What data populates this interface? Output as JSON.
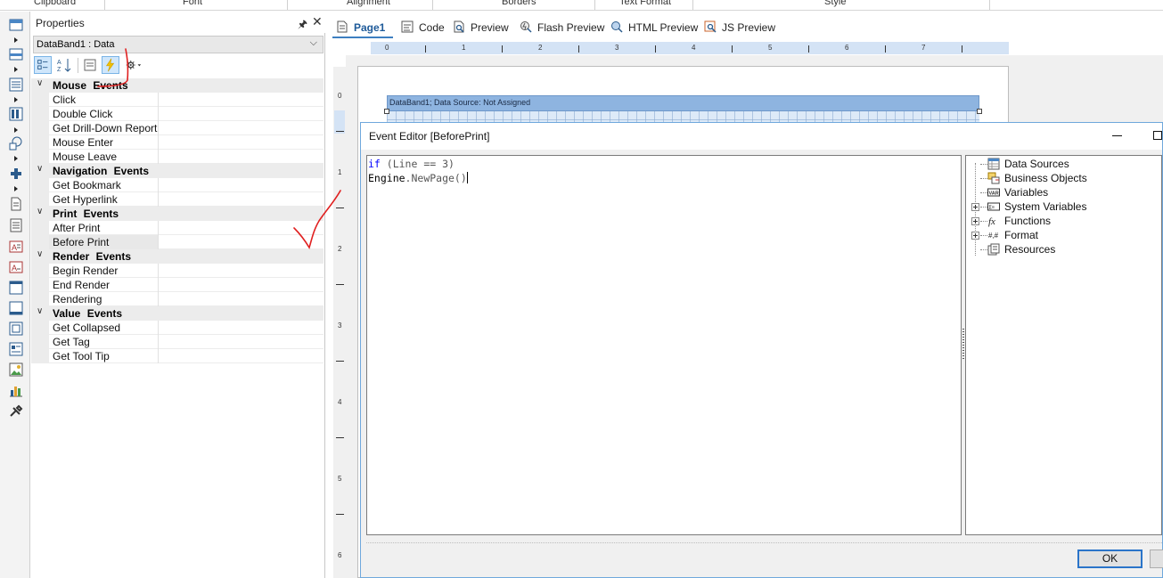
{
  "ribbon": {
    "groups": [
      "Clipboard",
      "Font",
      "Alignment",
      "Borders",
      "Text Format",
      "Style"
    ]
  },
  "toolbox": {
    "tools": [
      "band-icon",
      "cross-band-icon",
      "data-band-icon",
      "cross-tab-icon",
      "shape-icon",
      "component-icon",
      "page-icon",
      "report-icon",
      "text-icon",
      "rich-text-icon",
      "panel-icon",
      "container-icon",
      "subreport-icon",
      "text-box-icon",
      "image-icon",
      "chart-icon",
      "tools-icon"
    ]
  },
  "properties": {
    "title": "Properties",
    "selected_object": "DataBand1 : Data",
    "categories": [
      {
        "label": "Mouse  Events",
        "items": [
          "Click",
          "Double Click",
          "Get Drill-Down Report",
          "Mouse Enter",
          "Mouse Leave"
        ]
      },
      {
        "label": "Navigation  Events",
        "items": [
          "Get Bookmark",
          "Get Hyperlink"
        ]
      },
      {
        "label": "Print  Events",
        "items": [
          "After Print",
          "Before Print"
        ]
      },
      {
        "label": "Render  Events",
        "items": [
          "Begin Render",
          "End Render",
          "Rendering"
        ]
      },
      {
        "label": "Value  Events",
        "items": [
          "Get Collapsed",
          "Get Tag",
          "Get Tool Tip"
        ]
      }
    ],
    "selected_item": "Before Print"
  },
  "tabs": [
    {
      "label": "Page1",
      "icon": "page-icon",
      "active": true
    },
    {
      "label": "Code",
      "icon": "code-icon",
      "active": false
    },
    {
      "label": "Preview",
      "icon": "preview-icon",
      "active": false
    },
    {
      "label": "Flash Preview",
      "icon": "flash-preview-icon",
      "active": false
    },
    {
      "label": "HTML Preview",
      "icon": "html-preview-icon",
      "active": false
    },
    {
      "label": "JS Preview",
      "icon": "js-preview-icon",
      "active": false
    }
  ],
  "ruler": {
    "horizontal": [
      "0",
      "1",
      "2",
      "3",
      "4",
      "5",
      "6",
      "7"
    ],
    "vertical": [
      "0",
      "1",
      "2",
      "3",
      "4",
      "5",
      "6"
    ]
  },
  "band": {
    "label": "DataBand1; Data Source: Not Assigned"
  },
  "event_editor": {
    "title": "Event Editor [BeforePrint]",
    "code": {
      "line1_kw": "if",
      "line1_rest": " (Line == ",
      "line1_num": "3",
      "line1_end": ")",
      "line2_obj": "Engine",
      "line2_rest": ".NewPage()"
    },
    "dictionary": [
      {
        "label": "Data Sources",
        "expandable": false,
        "icon": "data-sources-icon"
      },
      {
        "label": "Business Objects",
        "expandable": false,
        "icon": "business-objects-icon"
      },
      {
        "label": "Variables",
        "expandable": false,
        "icon": "variables-icon"
      },
      {
        "label": "System Variables",
        "expandable": true,
        "icon": "system-variables-icon"
      },
      {
        "label": "Functions",
        "expandable": true,
        "icon": "functions-icon"
      },
      {
        "label": "Format",
        "expandable": true,
        "icon": "format-icon"
      },
      {
        "label": "Resources",
        "expandable": false,
        "icon": "resources-icon"
      }
    ],
    "ok_label": "OK"
  },
  "colors": {
    "accent": "#3d7fc1",
    "band": "#8eb4e0",
    "annotation": "#e02020",
    "keyword": "#0000ff"
  }
}
